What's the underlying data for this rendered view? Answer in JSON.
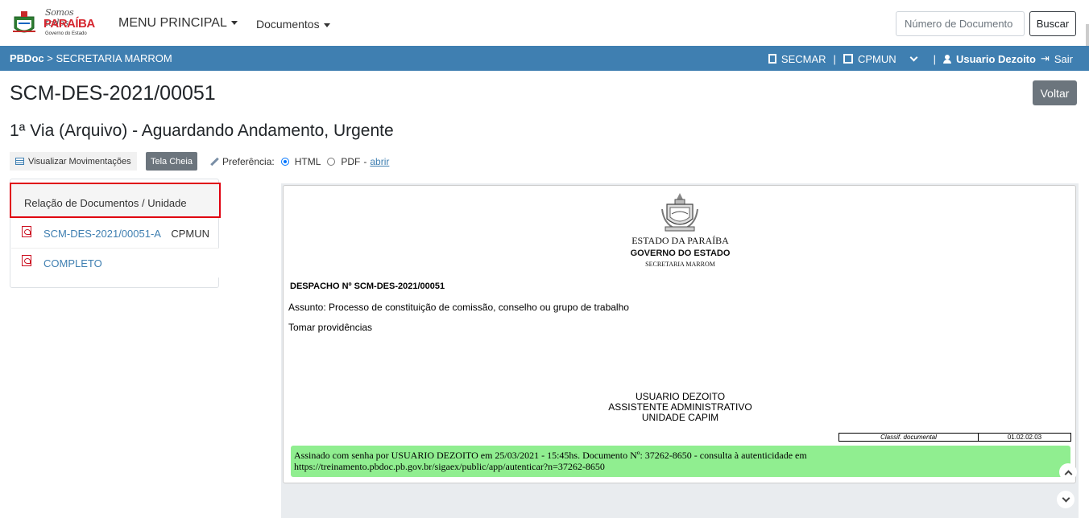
{
  "header": {
    "logo": {
      "line1": "Somos todos",
      "line2": "PARAÍBA",
      "line3": "Governo do Estado"
    },
    "menu_principal": "MENU PRINCIPAL",
    "menu_documentos": "Documentos",
    "search_placeholder": "Número de Documento",
    "search_button": "Buscar"
  },
  "bluebar": {
    "app": "PBDoc",
    "separator": ">",
    "section": "SECRETARIA MARROM",
    "lotacao": "SECMAR",
    "unidade": "CPMUN",
    "user": "Usuario Dezoito",
    "logout": "Sair"
  },
  "page": {
    "title": "SCM-DES-2021/00051",
    "subtitle": "1ª Via (Arquivo) - Aguardando Andamento, Urgente",
    "back_button": "Voltar"
  },
  "toolbar": {
    "movimentacoes": "Visualizar Movimentações",
    "tela_cheia": "Tela Cheia",
    "preferencia": "Preferência:",
    "html": "HTML",
    "pdf": "PDF",
    "dash": "-",
    "abrir": "abrir",
    "selected": "HTML"
  },
  "relacao": {
    "header": "Relação de Documentos / Unidade",
    "items": [
      {
        "label": "SCM-DES-2021/00051-A",
        "unit": "CPMUN"
      },
      {
        "label": "COMPLETO",
        "unit": ""
      }
    ]
  },
  "document": {
    "estado": "ESTADO DA PARAÍBA",
    "governo": "GOVERNO DO ESTADO",
    "secretaria": "SECRETARIA MARROM",
    "despacho": "DESPACHO Nº SCM-DES-2021/00051",
    "assunto": "Assunto: Processo de constituição de comissão, conselho ou grupo de trabalho",
    "texto": "Tomar providências",
    "sig_name": "USUARIO DEZOITO",
    "sig_role": "ASSISTENTE ADMINISTRATIVO",
    "sig_unit": "UNIDADE CAPIM",
    "classif_label": "Classif. documental",
    "classif_value": "01.02.02.03",
    "assinado_line1": "Assinado com senha por USUARIO DEZOITO em 25/03/2021 - 15:45hs. Documento Nº: 37262-8650 - consulta à autenticidade em",
    "assinado_line2": "https://treinamento.pbdoc.pb.gov.br/sigaex/public/app/autenticar?n=37262-8650"
  },
  "colors": {
    "bluebar": "#3f7fb1",
    "highlight_border": "#e0000f",
    "signature_bg": "#90ee90",
    "secondary_button": "#6c757d"
  }
}
